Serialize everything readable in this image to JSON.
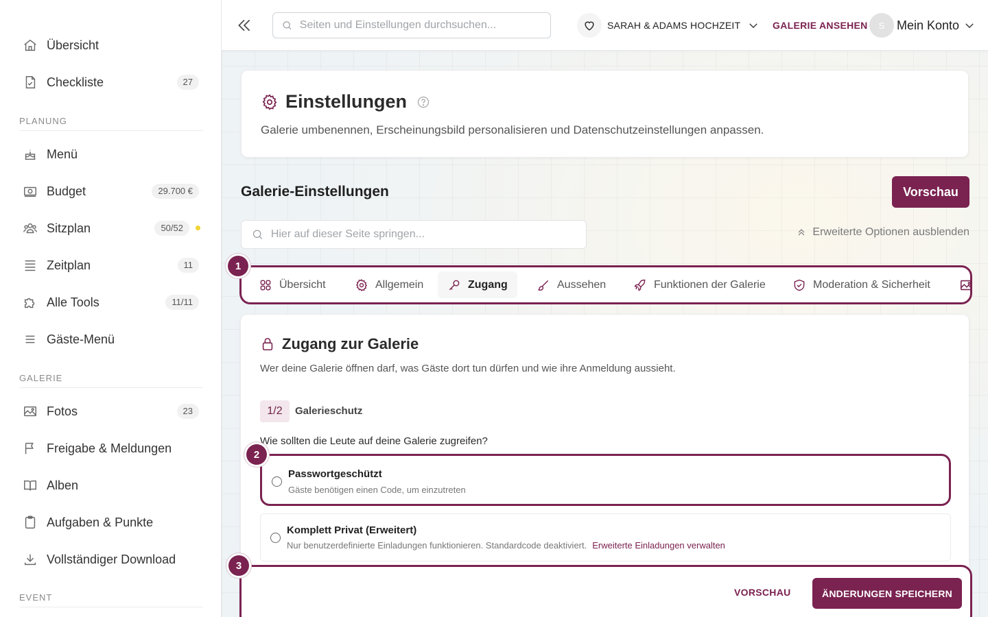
{
  "sidebar": {
    "items_top": [
      {
        "label": "Übersicht",
        "icon": "home-icon"
      },
      {
        "label": "Checkliste",
        "icon": "checklist-icon",
        "badge": "27"
      }
    ],
    "sections": [
      {
        "title": "PLANUNG",
        "items": [
          {
            "label": "Menü",
            "icon": "cake-icon"
          },
          {
            "label": "Budget",
            "icon": "money-icon",
            "badge": "29.700 €"
          },
          {
            "label": "Sitzplan",
            "icon": "people-icon",
            "badge": "50/52"
          },
          {
            "label": "Zeitplan",
            "icon": "timeline-icon",
            "badge": "11"
          },
          {
            "label": "Alle Tools",
            "icon": "puzzle-icon",
            "badge": "11/11"
          },
          {
            "label": "Gäste-Menü",
            "icon": "menu-icon"
          }
        ]
      },
      {
        "title": "GALERIE",
        "items": [
          {
            "label": "Fotos",
            "icon": "image-icon",
            "badge": "23"
          },
          {
            "label": "Freigabe & Meldungen",
            "icon": "flag-icon"
          },
          {
            "label": "Alben",
            "icon": "book-icon"
          },
          {
            "label": "Aufgaben & Punkte",
            "icon": "clipboard-icon"
          },
          {
            "label": "Vollständiger Download",
            "icon": "download-icon"
          }
        ]
      },
      {
        "title": "EVENT",
        "items": []
      }
    ]
  },
  "topbar": {
    "search_placeholder": "Seiten und Einstellungen durchsuchen...",
    "event_name": "SARAH & ADAMS HOCHZEIT",
    "view_gallery": "GALERIE ANSEHEN",
    "avatar_initial": "S",
    "account_label": "Mein Konto"
  },
  "settings": {
    "title": "Einstellungen",
    "description": "Galerie umbenennen, Erscheinungsbild personalisieren und Datenschutzeinstellungen anpassen."
  },
  "gallery_settings": {
    "heading": "Galerie-Einstellungen",
    "preview_button": "Vorschau",
    "page_search_placeholder": "Hier auf dieser Seite springen...",
    "advanced_toggle": "Erweiterte Optionen ausblenden"
  },
  "tabs": [
    {
      "label": "Übersicht",
      "icon": "grid-icon"
    },
    {
      "label": "Allgemein",
      "icon": "gear-icon"
    },
    {
      "label": "Zugang",
      "icon": "key-icon",
      "active": true
    },
    {
      "label": "Aussehen",
      "icon": "brush-icon"
    },
    {
      "label": "Funktionen der Galerie",
      "icon": "rocket-icon"
    },
    {
      "label": "Moderation & Sicherheit",
      "icon": "shield-icon"
    },
    {
      "label": "",
      "icon": "image-icon"
    }
  ],
  "step_badges": [
    "1",
    "2",
    "3"
  ],
  "access": {
    "title": "Zugang zur Galerie",
    "description": "Wer deine Galerie öffnen darf, was Gäste dort tun dürfen und wie ihre Anmeldung aussieht.",
    "step": "1/2",
    "step_label": "Galerieschutz",
    "question": "Wie sollten die Leute auf deine Galerie zugreifen?",
    "options": [
      {
        "title": "Passwortgeschützt",
        "description": "Gäste benötigen einen Code, um einzutreten"
      },
      {
        "title": "Komplett Privat (Erweitert)",
        "description": "Nur benutzerdefinierte Einladungen funktionieren. Standardcode deaktiviert.",
        "link": "Erweiterte Einladungen verwalten"
      }
    ]
  },
  "footer": {
    "preview": "VORSCHAU",
    "save": "ÄNDERUNGEN SPEICHERN"
  },
  "colors": {
    "accent": "#7a2250",
    "status_dot": "#f2d332"
  }
}
